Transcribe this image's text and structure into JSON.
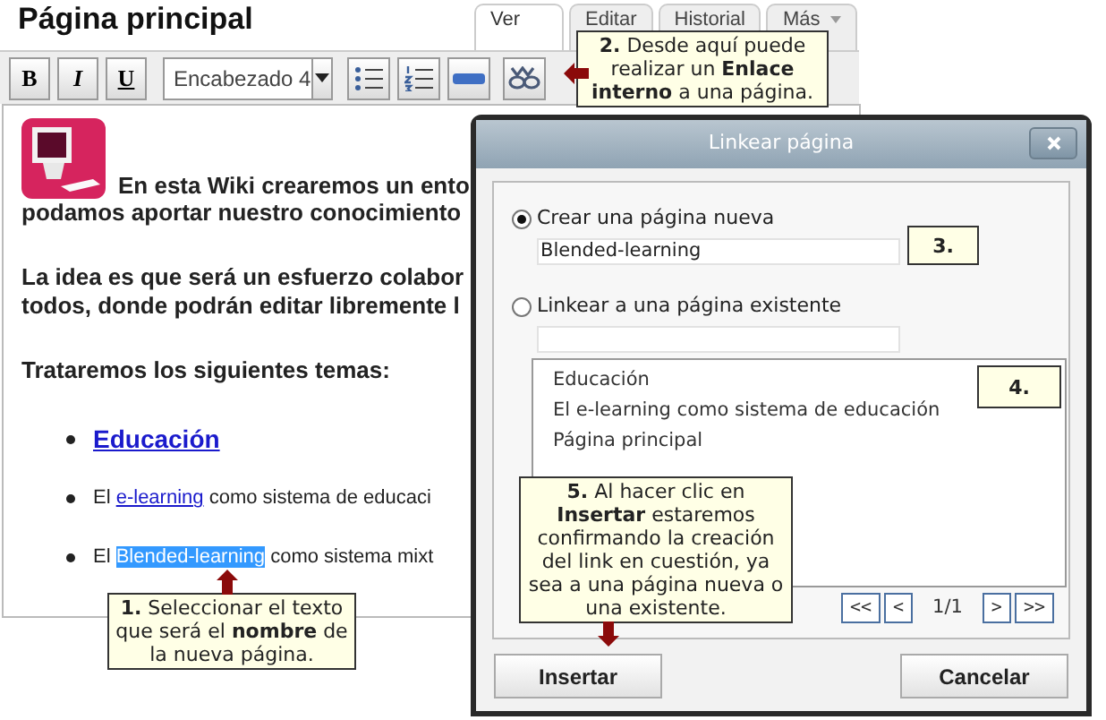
{
  "title": "Página principal",
  "tabs": [
    {
      "label": "Ver",
      "selected": true
    },
    {
      "label": "Editar",
      "selected": false
    },
    {
      "label": "Historial",
      "selected": false
    },
    {
      "label": "Más",
      "selected": false,
      "kind": "menu"
    }
  ],
  "toolbar": [
    {
      "kind": "bold",
      "label": "B"
    },
    {
      "kind": "italic",
      "label": "I"
    },
    {
      "kind": "underline",
      "label": "U"
    },
    {
      "kind": "dropdown",
      "value": "Encabezado 4"
    },
    {
      "kind": "bullets"
    },
    {
      "kind": "numbers"
    },
    {
      "kind": "rule"
    },
    {
      "kind": "link"
    }
  ],
  "content": [
    {
      "kind": "intro",
      "parts": [
        {
          "kind": "plain",
          "text": "En esta Wiki crearemos un ento"
        }
      ]
    },
    {
      "kind": "line",
      "parts": [
        {
          "kind": "plain",
          "text": "podamos aportar nuestro conocimiento"
        }
      ]
    },
    {
      "kind": "para",
      "parts": [
        {
          "kind": "plain",
          "text": "La idea es que será un esfuerzo colabor"
        }
      ]
    },
    {
      "kind": "line",
      "parts": [
        {
          "kind": "plain",
          "text": "todos, donde podrán editar libremente l"
        }
      ]
    },
    {
      "kind": "para",
      "parts": [
        {
          "kind": "plain",
          "text": "Trataremos los siguientes temas:"
        }
      ]
    },
    {
      "kind": "bullet_big",
      "parts": [
        {
          "kind": "link",
          "text": "Educación"
        }
      ]
    },
    {
      "kind": "bullet",
      "parts": [
        {
          "kind": "plain",
          "text": "El "
        },
        {
          "kind": "link",
          "text": "e-learning"
        },
        {
          "kind": "plain",
          "text": " como sistema de educaci"
        }
      ]
    },
    {
      "kind": "bullet",
      "parts": [
        {
          "kind": "plain",
          "text": "El "
        },
        {
          "kind": "selected",
          "text": "Blended-learning"
        },
        {
          "kind": "plain",
          "text": " como sistema mixt"
        }
      ]
    }
  ],
  "callouts": [
    "**2.** Desde aquí puede realizar un **Enlace interno** a una página.",
    "**1.** Seleccionar el texto que será el **nombre** de la nueva página.",
    "**3.**",
    "**4.**",
    "**5.** Al hacer clic en **Insertar** estaremos confirmando la creación del link en cuestión, ya sea a una página nueva o una existente."
  ],
  "dialog": {
    "title": "Linkear página",
    "options": [
      {
        "label": "Crear una página nueva",
        "selected": true,
        "value": "Blended-learning"
      },
      {
        "label": "Linkear a una página existente",
        "selected": false
      }
    ],
    "pages": [
      "Educación",
      "El e-learning como sistema de educación",
      "Página principal"
    ],
    "pager": {
      "first": "<<",
      "prev": "<",
      "page": "1/1",
      "next": ">",
      "last": ">>"
    },
    "buttons": [
      "Insertar",
      "Cancelar"
    ]
  }
}
